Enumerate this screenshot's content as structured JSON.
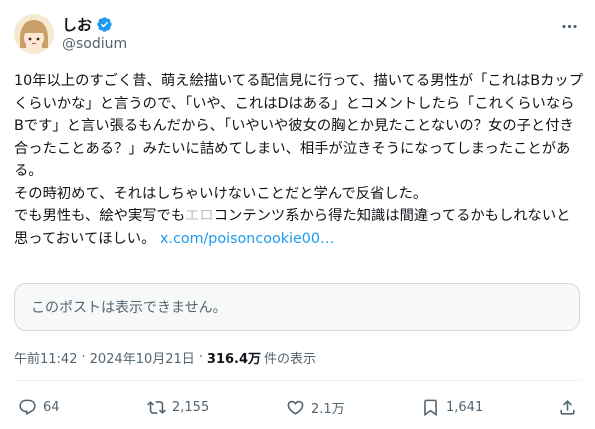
{
  "author": {
    "display_name": "しお",
    "handle": "@sodium",
    "avatar_icon": "cartoon-avatar-icon",
    "verified_icon": "verified-badge-icon",
    "more_icon": "more-options-icon"
  },
  "post": {
    "text": "10年以上のすごく昔、萌え絵描いてる配信見に行って、描いてる男性が「これはBカップくらいかな」と言うので、「いや、これはDはある」とコメントしたら「これくらいならBです」と言い張るもんだから、「いやいや彼女の胸とか見たことないの？女の子と付き合ったことある？」みたいに詰めてしまい、相手が泣きそうになってしまったことがある。\nその時初めて、それはしちゃいけないことだと学んで反省した。\nでも男性も、絵や実写でも",
    "censored_word": "エロ",
    "text_after": "コンテンツ系から得た知識は間違ってるかもしれないと思っておいてほしい。 ",
    "link": "x.com/poisoncookie00…"
  },
  "quote": {
    "text": "このポストは表示できません。"
  },
  "meta": {
    "time": "午前11:42",
    "date": "2024年10月21日",
    "separator": "·",
    "views_count": "316.4万",
    "views_label": "件の表示"
  },
  "actions": {
    "reply_count": "64",
    "repost_count": "2,155",
    "like_count": "2.1万",
    "bookmark_count": "1,641"
  },
  "colors": {
    "accent": "#1d9bf0",
    "secondary_text": "#536471",
    "border": "#cfd9de"
  }
}
